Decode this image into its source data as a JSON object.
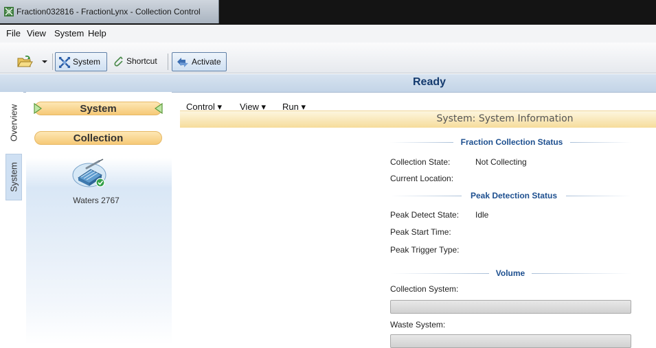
{
  "window": {
    "title": "Fraction032816 - FractionLynx - Collection Control"
  },
  "menubar": {
    "items": [
      "File",
      "View",
      "System",
      "Help"
    ]
  },
  "toolbar": {
    "system_label": "System",
    "shortcut_label": "Shortcut",
    "activate_label": "Activate"
  },
  "status": {
    "text": "Ready"
  },
  "vtabs": [
    "Overview",
    "System"
  ],
  "sidebar": {
    "system_label": "System",
    "collection_label": "Collection",
    "device_name": "Waters 2767"
  },
  "center_menus": [
    "Control ▾",
    "View ▾",
    "Run ▾"
  ],
  "panel": {
    "title": "System: System Information",
    "fraction_collection": {
      "heading": "Fraction Collection Status",
      "collection_state_label": "Collection State:",
      "collection_state_value": "Not Collecting",
      "current_location_label": "Current Location:",
      "current_location_value": ""
    },
    "peak_detection": {
      "heading": "Peak Detection Status",
      "peak_detect_state_label": "Peak Detect State:",
      "peak_detect_state_value": "Idle",
      "peak_start_time_label": "Peak Start Time:",
      "peak_start_time_value": "",
      "peak_trigger_type_label": "Peak Trigger Type:",
      "peak_trigger_type_value": ""
    },
    "volume": {
      "heading": "Volume",
      "collection_system_label": "Collection System:",
      "collection_system_fill_pct": 0,
      "waste_system_label": "Waste System:",
      "waste_system_fill_pct": 0
    }
  },
  "colors": {
    "accent_gold": "#f6c977",
    "status_blue": "#143a6e",
    "heading_blue": "#1d4f8f"
  }
}
